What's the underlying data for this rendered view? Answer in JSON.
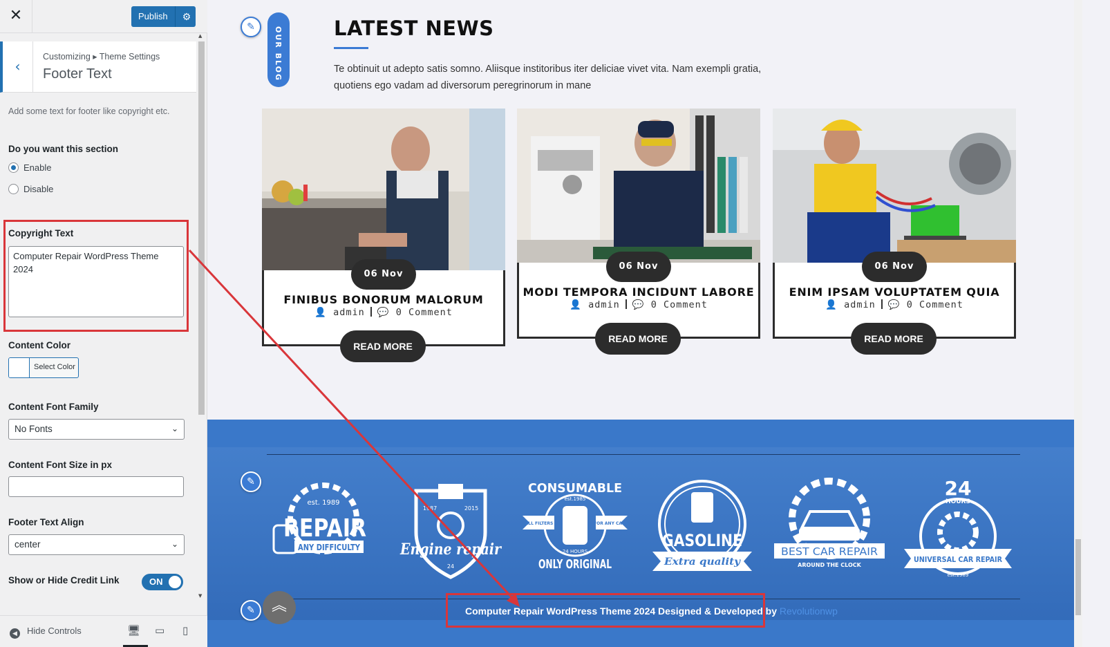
{
  "customizer": {
    "close_icon": "✕",
    "publish_label": "Publish",
    "breadcrumb": "Customizing ▸ Theme Settings",
    "section_title": "Footer Text",
    "description": "Add some text for footer like copyright etc.",
    "section_question": "Do you want this section",
    "radio_enable": "Enable",
    "radio_disable": "Disable",
    "selected_radio": "Enable",
    "copyright_label": "Copyright Text",
    "copyright_value": "Computer Repair WordPress Theme 2024",
    "content_color_label": "Content Color",
    "select_color_label": "Select Color",
    "font_family_label": "Content Font Family",
    "font_family_value": "No Fonts",
    "font_size_label": "Content Font Size in px",
    "font_size_value": "",
    "align_label": "Footer Text Align",
    "align_value": "center",
    "credit_toggle_label": "Show or Hide Credit Link",
    "credit_toggle_value": "ON",
    "hide_controls_label": "Hide Controls",
    "accent_color": "#2271b1",
    "highlight_color": "#d9363a"
  },
  "preview": {
    "blog_pill": "OUR BLOG",
    "news_title": "LATEST NEWS",
    "news_text": "Te obtinuit ut adepto satis somno. Aliisque institoribus iter deliciae vivet vita. Nam exempli gratia, quotiens ego vadam ad diversorum peregrinorum in mane",
    "cards": [
      {
        "date": "06 Nov",
        "title": "FINIBUS BONORUM MALORUM",
        "author": "admin",
        "comments": "0 Comment",
        "button": "READ MORE"
      },
      {
        "date": "06 Nov",
        "title": "MODI TEMPORA INCIDUNT LABORE",
        "author": "admin",
        "comments": "0 Comment",
        "button": "READ MORE"
      },
      {
        "date": "06 Nov",
        "title": "ENIM IPSAM VOLUPTATEM QUIA",
        "author": "admin",
        "comments": "0 Comment",
        "button": "READ MORE"
      }
    ],
    "logos": [
      {
        "lines": [
          "est. 1989",
          "REPAIR",
          "ANY DIFFICULTY"
        ]
      },
      {
        "lines": [
          "1987",
          "2015",
          "Engine repair",
          "24"
        ]
      },
      {
        "lines": [
          "CONSUMABLE",
          "est.1985",
          "ALL FILTERS",
          "FOR ANY CARS",
          "24 HOURS",
          "ONLY ORIGINAL"
        ]
      },
      {
        "lines": [
          "GASOLINE",
          "Extra quality"
        ]
      },
      {
        "lines": [
          "BEST CAR REPAIR",
          "AROUND THE CLOCK"
        ]
      },
      {
        "lines": [
          "24",
          "HOURS",
          "UNIVERSAL CAR REPAIR",
          "est.1989"
        ]
      }
    ],
    "footer_credit": "Computer Repair WordPress Theme 2024 Designed & Developed by",
    "footer_link": "Revolutionwp",
    "footer_color": "#3a78c9"
  }
}
